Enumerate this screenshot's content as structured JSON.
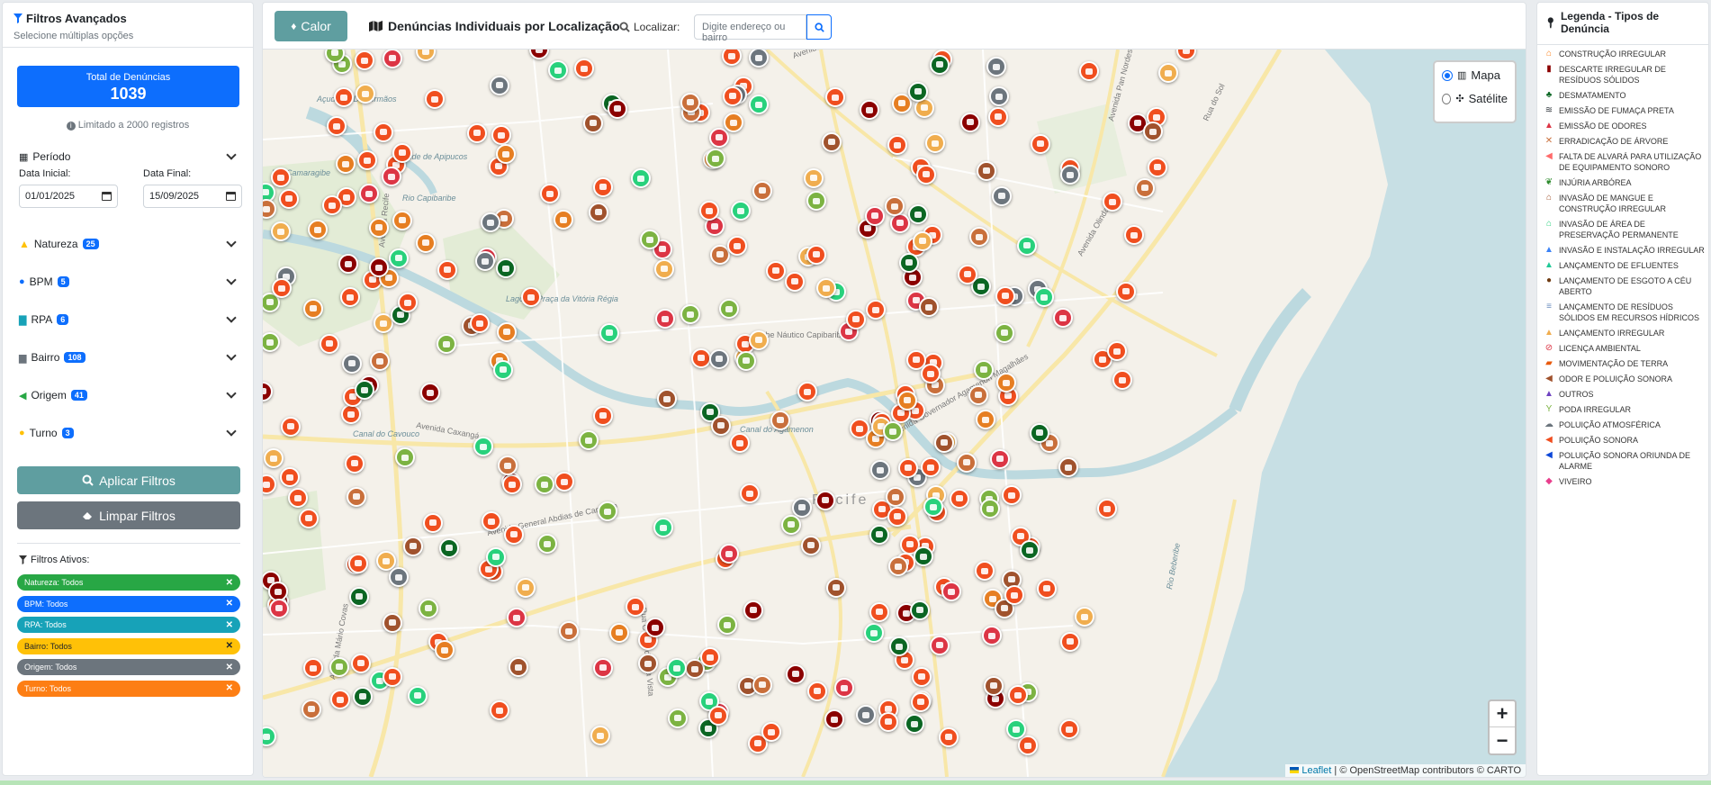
{
  "sidebar": {
    "title": "Filtros Avançados",
    "subtitle": "Selecione múltiplas opções",
    "total_label": "Total de Denúncias",
    "total_value": "1039",
    "limit_text": "Limitado a 2000 registros",
    "period": {
      "label": "Período",
      "start_label": "Data Inicial:",
      "start_value": "01/01/2025",
      "end_label": "Data Final:",
      "end_value": "15/09/2025"
    },
    "filters": [
      {
        "label": "Natureza",
        "count": "25"
      },
      {
        "label": "BPM",
        "count": "5"
      },
      {
        "label": "RPA",
        "count": "6"
      },
      {
        "label": "Bairro",
        "count": "108"
      },
      {
        "label": "Origem",
        "count": "41"
      },
      {
        "label": "Turno",
        "count": "3"
      }
    ],
    "apply_label": "Aplicar Filtros",
    "clear_label": "Limpar Filtros",
    "active_title": "Filtros Ativos:",
    "active_chips": [
      {
        "text": "Natureza: Todos",
        "color": "#28a745"
      },
      {
        "text": "BPM: Todos",
        "color": "#0d6efd"
      },
      {
        "text": "RPA: Todos",
        "color": "#17a2b8"
      },
      {
        "text": "Bairro: Todos",
        "color": "#ffc107"
      },
      {
        "text": "Origem: Todos",
        "color": "#6c757d"
      },
      {
        "text": "Turno: Todos",
        "color": "#fd7e14"
      }
    ]
  },
  "topbar": {
    "heat_label": "Calor",
    "title": "Denúncias Individuais por Localização",
    "locate_label": "Localizar:",
    "search_placeholder": "Digite endereço ou bairro"
  },
  "map": {
    "layers": {
      "map_label": "Mapa",
      "satellite_label": "Satélite",
      "selected": "Mapa"
    },
    "zoom_in": "+",
    "zoom_out": "−",
    "attribution_link": "Leaflet",
    "attribution_text": "| © OpenStreetMap contributors © CARTO",
    "street_labels": [
      "Avenida Presidente Kennedy",
      "Avenida Pan Nordestina",
      "Rua do Sol",
      "Avenida Olinda",
      "Avenida Governador Agamenon Magalhães",
      "Açude de Dois Irmãos",
      "Açude de Apipucos",
      "Rio Camaragibe",
      "Rio Capibaribe",
      "Avenida Caxangá",
      "Avenida General Abdias de Carvalho",
      "Canal do Cavouco",
      "Canal do Agamenon",
      "Clube Náutico Capibaribe",
      "Rio Beberibe",
      "Avenida Recife",
      "Lago da Praça da Vitória Régia",
      "Recife",
      "Avenida Mário Covas",
      "Rua Conde da Boa Vista"
    ]
  },
  "legend": {
    "title": "Legenda - Tipos de Denúncia",
    "items": [
      {
        "label": "Construção Irregular",
        "color": "#fd7e14",
        "icon": "house-icon"
      },
      {
        "label": "Descarte Irregular de Resíduos Sólidos",
        "color": "#8b0000",
        "icon": "trash-icon"
      },
      {
        "label": "Desmatamento",
        "color": "#0b6623",
        "icon": "tree-icon"
      },
      {
        "label": "Emissão de Fumaça Preta",
        "color": "#343a40",
        "icon": "smog-icon"
      },
      {
        "label": "Emissão de Odores",
        "color": "#dc3545",
        "icon": "warning-icon"
      },
      {
        "label": "Erradicação de Árvore",
        "color": "#c96f3b",
        "icon": "axe-icon"
      },
      {
        "label": "Falta de Alvará para Utilização de Equipamento Sonoro",
        "color": "#ff6b6b",
        "icon": "volume-icon"
      },
      {
        "label": "Injúria Arbórea",
        "color": "#2e8b2e",
        "icon": "leaf-icon"
      },
      {
        "label": "Invasão de Mangue e Construção Irregular",
        "color": "#a0522d",
        "icon": "house-icon"
      },
      {
        "label": "Invasão de Área de Preservação Permanente",
        "color": "#28d17c",
        "icon": "home-icon"
      },
      {
        "label": "Invasão e Instalação Irregular",
        "color": "#3b82f6",
        "icon": "warning-icon"
      },
      {
        "label": "Lançamento de Efluentes",
        "color": "#20c997",
        "icon": "warning-icon"
      },
      {
        "label": "Lançamento de Esgoto a Céu Aberto",
        "color": "#6f3b12",
        "icon": "poop-icon"
      },
      {
        "label": "Lançamento de Resíduos Sólidos em Recursos Hídricos",
        "color": "#6c8ebf",
        "icon": "water-icon"
      },
      {
        "label": "Lançamento Irregular",
        "color": "#f0ad4e",
        "icon": "warning-icon"
      },
      {
        "label": "Licença Ambiental",
        "color": "#dc3545",
        "icon": "ban-icon"
      },
      {
        "label": "Movimentação de Terra",
        "color": "#e8590c",
        "icon": "truck-icon"
      },
      {
        "label": "Odor e Poluição Sonora",
        "color": "#a0522d",
        "icon": "volume-icon"
      },
      {
        "label": "Outros",
        "color": "#6f42c1",
        "icon": "warning-icon"
      },
      {
        "label": "Poda Irregular",
        "color": "#7cb342",
        "icon": "seedling-icon"
      },
      {
        "label": "Poluição Atmosférica",
        "color": "#6c757d",
        "icon": "cloud-icon"
      },
      {
        "label": "Poluição Sonora",
        "color": "#f04e1f",
        "icon": "volume-icon"
      },
      {
        "label": "Poluição Sonora Oriunda de Alarme",
        "color": "#0d47d8",
        "icon": "volume-icon"
      },
      {
        "label": "Viveiro",
        "color": "#e83e8c",
        "icon": "fish-icon"
      }
    ]
  }
}
